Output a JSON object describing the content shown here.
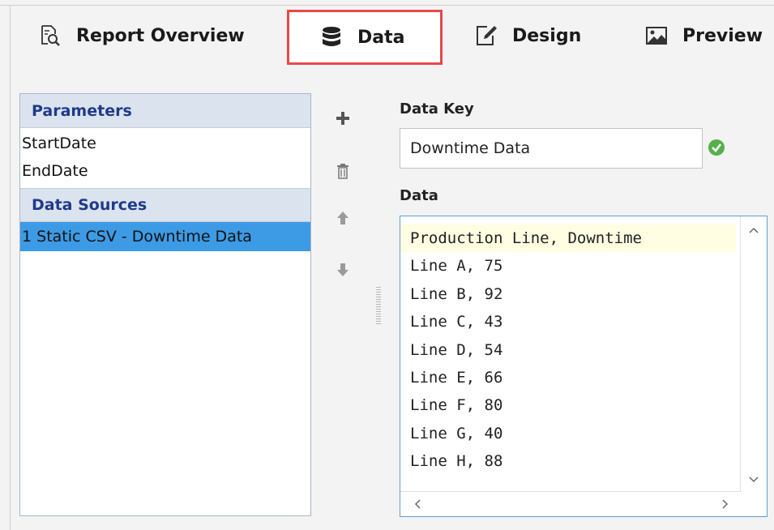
{
  "tabs": [
    {
      "label": "Report Overview",
      "icon": "report-search-icon"
    },
    {
      "label": "Data",
      "icon": "database-icon",
      "active": true
    },
    {
      "label": "Design",
      "icon": "edit-icon"
    },
    {
      "label": "Preview",
      "icon": "image-icon"
    }
  ],
  "left_panel": {
    "parameters_header": "Parameters",
    "parameters": [
      "StartDate",
      "EndDate"
    ],
    "data_sources_header": "Data Sources",
    "data_sources": [
      "1 Static CSV - Downtime Data"
    ]
  },
  "editor": {
    "data_key_label": "Data Key",
    "data_key_value": "Downtime Data",
    "data_label": "Data",
    "data_lines": [
      "Production Line, Downtime",
      "Line A, 75",
      "Line B, 92",
      "Line C, 43",
      "Line D, 54",
      "Line E, 66",
      "Line F, 80",
      "Line G, 40",
      "Line H, 88"
    ]
  },
  "colors": {
    "accent_selection": "#3d9be5",
    "active_tab_border": "#e8484a",
    "section_header_text": "#1f3a8a",
    "ok_green": "#56b04b"
  }
}
